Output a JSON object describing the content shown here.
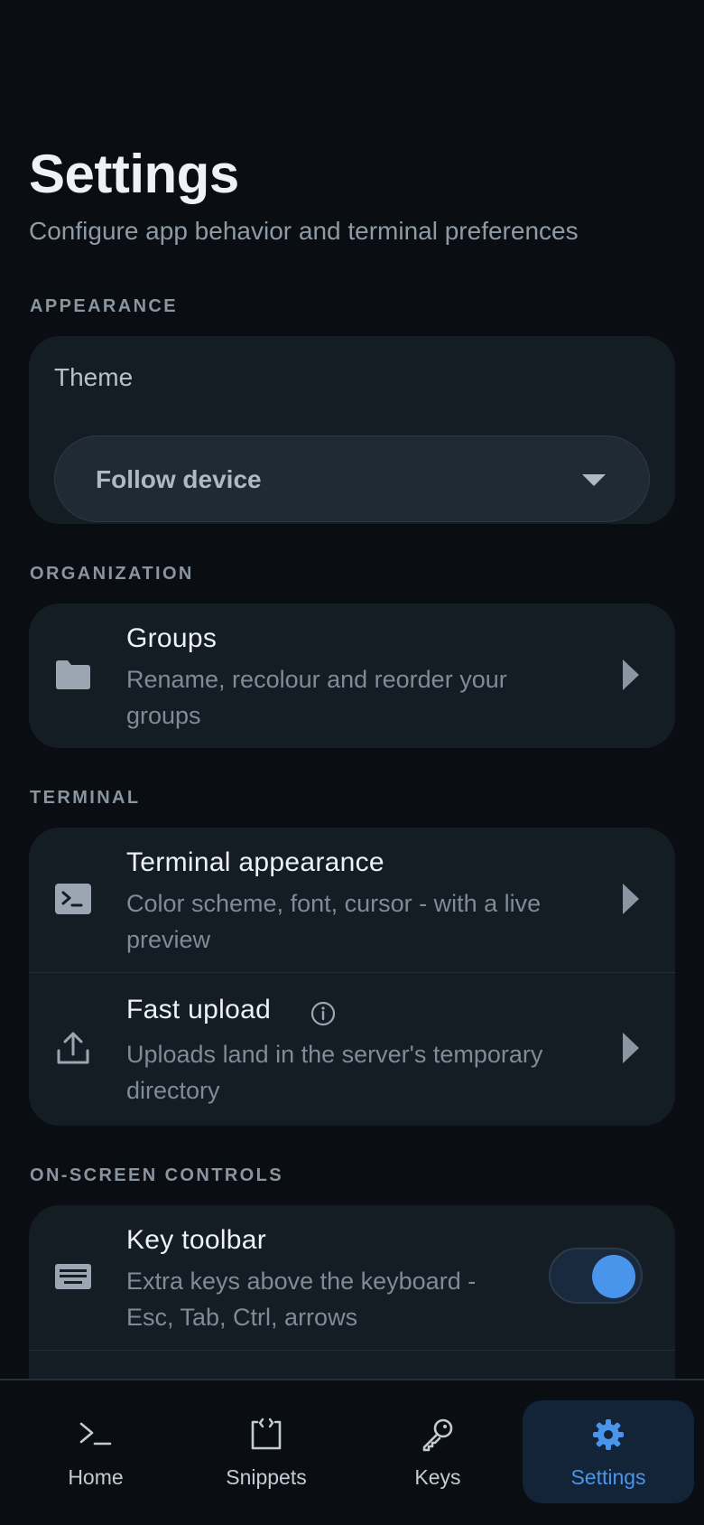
{
  "header": {
    "title": "Settings",
    "subtitle": "Configure app behavior and terminal preferences"
  },
  "sections": {
    "appearance": {
      "label": "APPEARANCE",
      "theme_label": "Theme",
      "theme_value": "Follow device"
    },
    "organization": {
      "label": "ORGANIZATION",
      "groups": {
        "title": "Groups",
        "description": "Rename, recolour and reorder your groups",
        "icon": "folder-icon"
      }
    },
    "terminal": {
      "label": "TERMINAL",
      "appearance": {
        "title": "Terminal appearance",
        "description": "Color scheme, font, cursor - with a live preview",
        "icon": "terminal-icon"
      },
      "fast_upload": {
        "title": "Fast upload",
        "description": "Uploads land in the server's temporary directory",
        "icon": "upload-icon"
      }
    },
    "onscreen": {
      "label": "ON-SCREEN CONTROLS",
      "key_toolbar": {
        "title": "Key toolbar",
        "description": "Extra keys above the keyboard - Esc, Tab, Ctrl, arrows",
        "icon": "keyboard-icon",
        "enabled": true
      }
    }
  },
  "nav": {
    "items": [
      {
        "label": "Home",
        "icon": "terminal-prompt-icon",
        "active": false
      },
      {
        "label": "Snippets",
        "icon": "snippet-icon",
        "active": false
      },
      {
        "label": "Keys",
        "icon": "key-icon",
        "active": false
      },
      {
        "label": "Settings",
        "icon": "gear-icon",
        "active": true
      }
    ]
  },
  "colors": {
    "background": "#0a0e13",
    "card": "#141c24",
    "accent": "#4a95ec",
    "muted_text": "#7f8b97"
  }
}
